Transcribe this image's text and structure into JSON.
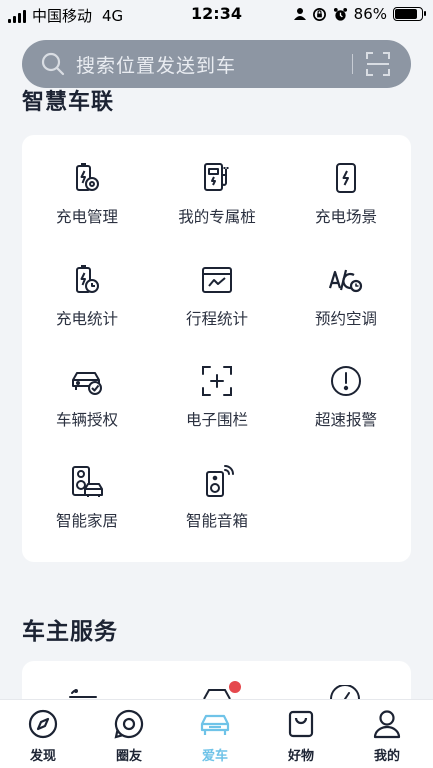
{
  "status_bar": {
    "carrier": "中国移动",
    "network": "4G",
    "time": "12:34",
    "battery": "86%",
    "battery_level": 0.86
  },
  "search": {
    "placeholder": "搜索位置发送到车"
  },
  "section_cut_title": "智慧车联",
  "grid": [
    {
      "label": "充电管理",
      "icon": "battery-gear-icon"
    },
    {
      "label": "我的专属桩",
      "icon": "charging-pile-icon"
    },
    {
      "label": "充电场景",
      "icon": "phone-charge-icon"
    },
    {
      "label": "充电统计",
      "icon": "battery-clock-icon"
    },
    {
      "label": "行程统计",
      "icon": "trip-chart-icon"
    },
    {
      "label": "预约空调",
      "icon": "ac-schedule-icon"
    },
    {
      "label": "车辆授权",
      "icon": "car-check-icon"
    },
    {
      "label": "电子围栏",
      "icon": "geofence-icon"
    },
    {
      "label": "超速报警",
      "icon": "alert-icon"
    },
    {
      "label": "智能家居",
      "icon": "home-car-icon"
    },
    {
      "label": "智能音箱",
      "icon": "speaker-icon"
    }
  ],
  "section2_title": "车主服务",
  "tabs": [
    {
      "label": "发现",
      "icon": "compass-icon"
    },
    {
      "label": "圈友",
      "icon": "chat-icon"
    },
    {
      "label": "爱车",
      "icon": "car-icon",
      "active": true
    },
    {
      "label": "好物",
      "icon": "shop-icon"
    },
    {
      "label": "我的",
      "icon": "user-icon"
    }
  ],
  "colors": {
    "accent": "#6fc3e8",
    "badge": "#e5484d",
    "search_bg": "#8d96a3"
  }
}
